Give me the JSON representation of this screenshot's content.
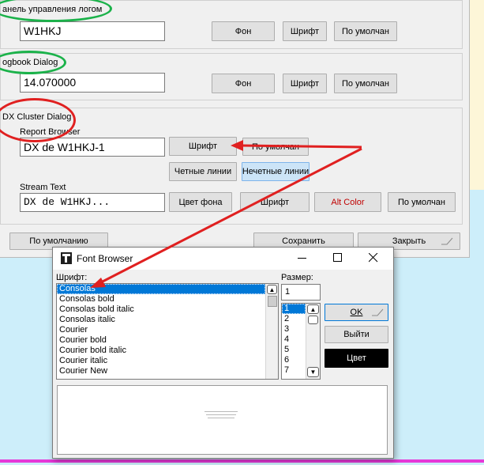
{
  "main": {
    "group1": {
      "label": "анель управления логом",
      "callsign": "W1HKJ",
      "buttons": {
        "bg": "Фон",
        "font": "Шрифт",
        "default": "По умолчан"
      }
    },
    "group2": {
      "label": "ogbook Dialog",
      "freq": "14.070000",
      "buttons": {
        "bg": "Фон",
        "font": "Шрифт",
        "default": "По умолчан"
      }
    },
    "group3": {
      "label": "DX Cluster Dialog",
      "report_label": "Report Browser",
      "report_value": "DX de W1HKJ-1",
      "font_btn": "Шрифт",
      "default_btn": "По умолчан",
      "even_btn": "Четные линии",
      "odd_btn": "Нечетные линии",
      "stream_label": "Stream Text",
      "stream_value": "DX de W1HKJ...",
      "bgcolor_btn": "Цвет фона",
      "stream_font_btn": "Шрифт",
      "alt_color_btn": "Alt Color",
      "stream_default_btn": "По умолчан"
    },
    "footer": {
      "default_all": "По умолчанию",
      "save": "Сохранить",
      "close": "Закрыть"
    }
  },
  "font_browser": {
    "title": "Font Browser",
    "font_label": "Шрифт:",
    "size_label": "Размер:",
    "size_value": "1",
    "fonts": [
      "Consolas",
      "Consolas bold",
      "Consolas bold italic",
      "Consolas italic",
      "Courier",
      "Courier bold",
      "Courier bold italic",
      "Courier italic",
      "Courier New"
    ],
    "selected_font": "Consolas",
    "sizes": [
      "1",
      "2",
      "3",
      "4",
      "5",
      "6",
      "7"
    ],
    "ok": "OK",
    "exit": "Выйти",
    "color": "Цвет"
  },
  "colors": {
    "selection": "#0078d7",
    "annotation_green": "#1bb24a",
    "annotation_red": "#e02020",
    "alt_color_text": "#c00000"
  },
  "icons": [
    "app-icon",
    "minimize-icon",
    "maximize-icon",
    "close-icon",
    "scroll-up-icon",
    "scroll-down-icon",
    "resize-grip-icon"
  ]
}
